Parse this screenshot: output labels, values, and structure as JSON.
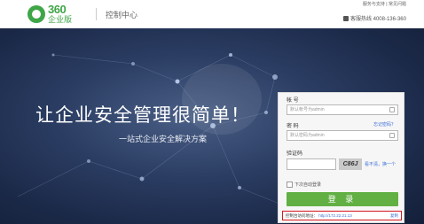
{
  "header": {
    "logo_number": "360",
    "logo_subtitle": "企业版",
    "app_title": "控制中心",
    "top_links": "服务与支持 | 常见问题",
    "hotline": "客服热线 4008-136-360"
  },
  "banner": {
    "slogan": "让企业安全管理很简单！",
    "subslogan": "一站式企业安全解决方案"
  },
  "login": {
    "account_label": "帐 号",
    "account_placeholder": "默认帐号为admin",
    "password_label": "密 码",
    "forgot_link": "忘记密码？",
    "password_placeholder": "默认密码为admin",
    "captcha_label": "验证码",
    "captcha_code": "C86J",
    "captcha_refresh": "看不清，换一个",
    "remember_label": "下次自动登录",
    "login_button": "登 录",
    "address_label": "控制台访问地址：",
    "address_value": "http://172.22.21.13",
    "address_copy": "复制"
  },
  "colors": {
    "brand_green": "#3fa648",
    "button_green": "#62b043",
    "highlight_red": "#d7171f",
    "link_blue": "#3a6fd8"
  }
}
